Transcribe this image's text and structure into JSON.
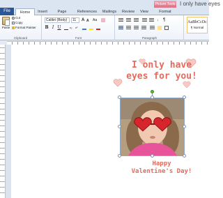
{
  "title_bar": {
    "context_tab": "Picture Tools",
    "title_text": "I only have eyes"
  },
  "tabs": {
    "file": "File",
    "items": [
      "Home",
      "Insert",
      "Page Layout",
      "References",
      "Mailings",
      "Review",
      "View",
      "Format"
    ]
  },
  "ribbon": {
    "clipboard": {
      "paste_label": "Paste",
      "cut_label": "Cut",
      "copy_label": "Copy",
      "format_painter_label": "Format Painter",
      "group_label": "Clipboard"
    },
    "font": {
      "font_name": "Calibri (Body)",
      "font_size": "11",
      "bold": "B",
      "italic": "I",
      "underline": "U",
      "group_label": "Font"
    },
    "paragraph": {
      "group_label": "Paragraph"
    },
    "styles": {
      "sample": "AaBbCcDc",
      "name": "¶ Normal"
    }
  },
  "document": {
    "headline_line1": "I only have",
    "headline_line2": "eyes for you!",
    "footer_line1": "Happy",
    "footer_line2": "Valentine's Day!"
  },
  "colors": {
    "accent_text": "#e36c5c",
    "heart_fill": "#f6c9c4",
    "file_tab": "#2b579a"
  }
}
